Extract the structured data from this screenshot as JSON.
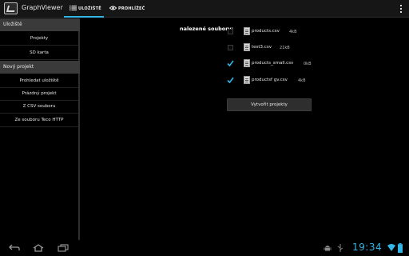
{
  "app": {
    "title": "GraphViewer",
    "icon": "graph-app-icon"
  },
  "tabs": [
    {
      "label": "ULOŽIŠTĚ",
      "icon": "list-icon",
      "active": true
    },
    {
      "label": "PROHLÍŽEČ",
      "icon": "eye-icon",
      "active": false
    }
  ],
  "sidebar": {
    "storage_header": "Uložiště",
    "storage_items": [
      {
        "label": "Projekty"
      },
      {
        "label": "SD karta"
      }
    ],
    "new_project_header": "Nový projekt",
    "new_project_items": [
      {
        "label": "Prohledat uložiště"
      },
      {
        "label": "Prázdný projekt"
      },
      {
        "label": "Z CSV souboru"
      },
      {
        "label": "Ze souboru Teco HTTP"
      }
    ]
  },
  "main": {
    "found_label": "nalezené soubory:",
    "files": [
      {
        "name": "products.csv",
        "size": "4kB",
        "checked": false
      },
      {
        "name": "test3.csv",
        "size": "21kB",
        "checked": false
      },
      {
        "name": "products_small.csv",
        "size": "0kB",
        "checked": true
      },
      {
        "name": "productsf gv.csv",
        "size": "4kB",
        "checked": true
      }
    ],
    "create_button": "Vytvořit projekty"
  },
  "system_bar": {
    "clock": "19:34",
    "accent": "#33b5e5",
    "nav_icons": [
      "back-icon",
      "home-icon",
      "recent-apps-icon"
    ],
    "status_icons": [
      "android-debug-icon",
      "usb-icon",
      "wifi-icon",
      "battery-icon"
    ]
  }
}
